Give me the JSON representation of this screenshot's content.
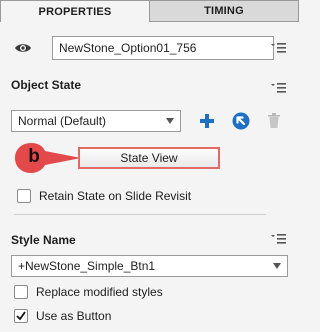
{
  "tabs": [
    {
      "label": "PROPERTIES"
    },
    {
      "label": "TIMING"
    }
  ],
  "item_name": {
    "value": "NewStone_Option01_756"
  },
  "object_state": {
    "title": "Object State",
    "selected_state": "Normal (Default)",
    "state_view_button": "State View",
    "callout_label": "b",
    "retain_state_label": "Retain State on Slide Revisit",
    "retain_state_checked": false
  },
  "style": {
    "title": "Style Name",
    "selected_style": "+NewStone_Simple_Btn1",
    "replace_modified_label": "Replace modified styles",
    "replace_modified_checked": false,
    "use_as_button_label": "Use as Button",
    "use_as_button_checked": true
  },
  "colors": {
    "accent_blue": "#1f6fc5",
    "callout_red": "#e3494a",
    "highlight_red": "#e36a64"
  }
}
